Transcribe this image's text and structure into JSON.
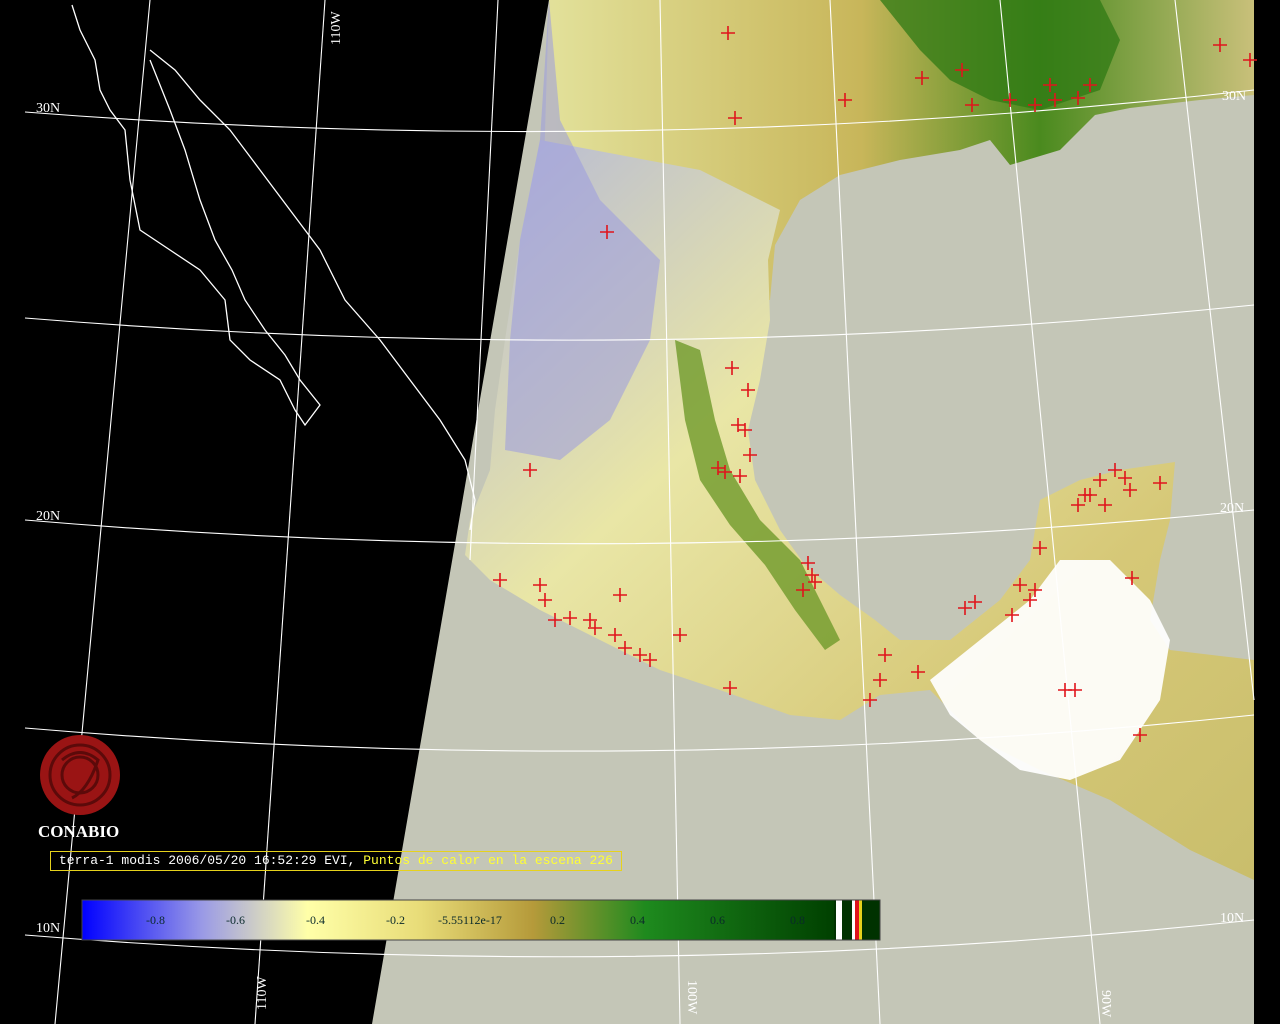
{
  "colors": {
    "space": "#000000",
    "ocean": "#c4c6b7",
    "coast": "#ffffff",
    "hotspot": "#e0141c",
    "logo": "#9a1414",
    "caption_border": "#e6d21c",
    "caption_highlight": "#ffff33"
  },
  "grid_labels": {
    "lat": [
      "30N",
      "20N",
      "10N",
      "30N",
      "20N",
      "10N"
    ],
    "lon": [
      "110W",
      "110W",
      "100W",
      "90W"
    ]
  },
  "logo": {
    "name": "CONABIO",
    "icon": "conabio-logo-icon"
  },
  "caption": {
    "prefix": "terra-1 modis 2006/05/20 16:52:29 EVI, ",
    "highlight": "Puntos de calor en la escena 226"
  },
  "colorbar": {
    "ticks": [
      "-0.8",
      "-0.6",
      "-0.4",
      "-0.2",
      "-5.55112e-17",
      "0.2",
      "0.4",
      "0.6",
      "0.8"
    ],
    "colors": [
      "#0000ff",
      "#9a9ae6",
      "#ffffa8",
      "#e8dc78",
      "#b59a3a",
      "#1e8a1e",
      "#006400"
    ]
  },
  "hotspots_count": 226
}
